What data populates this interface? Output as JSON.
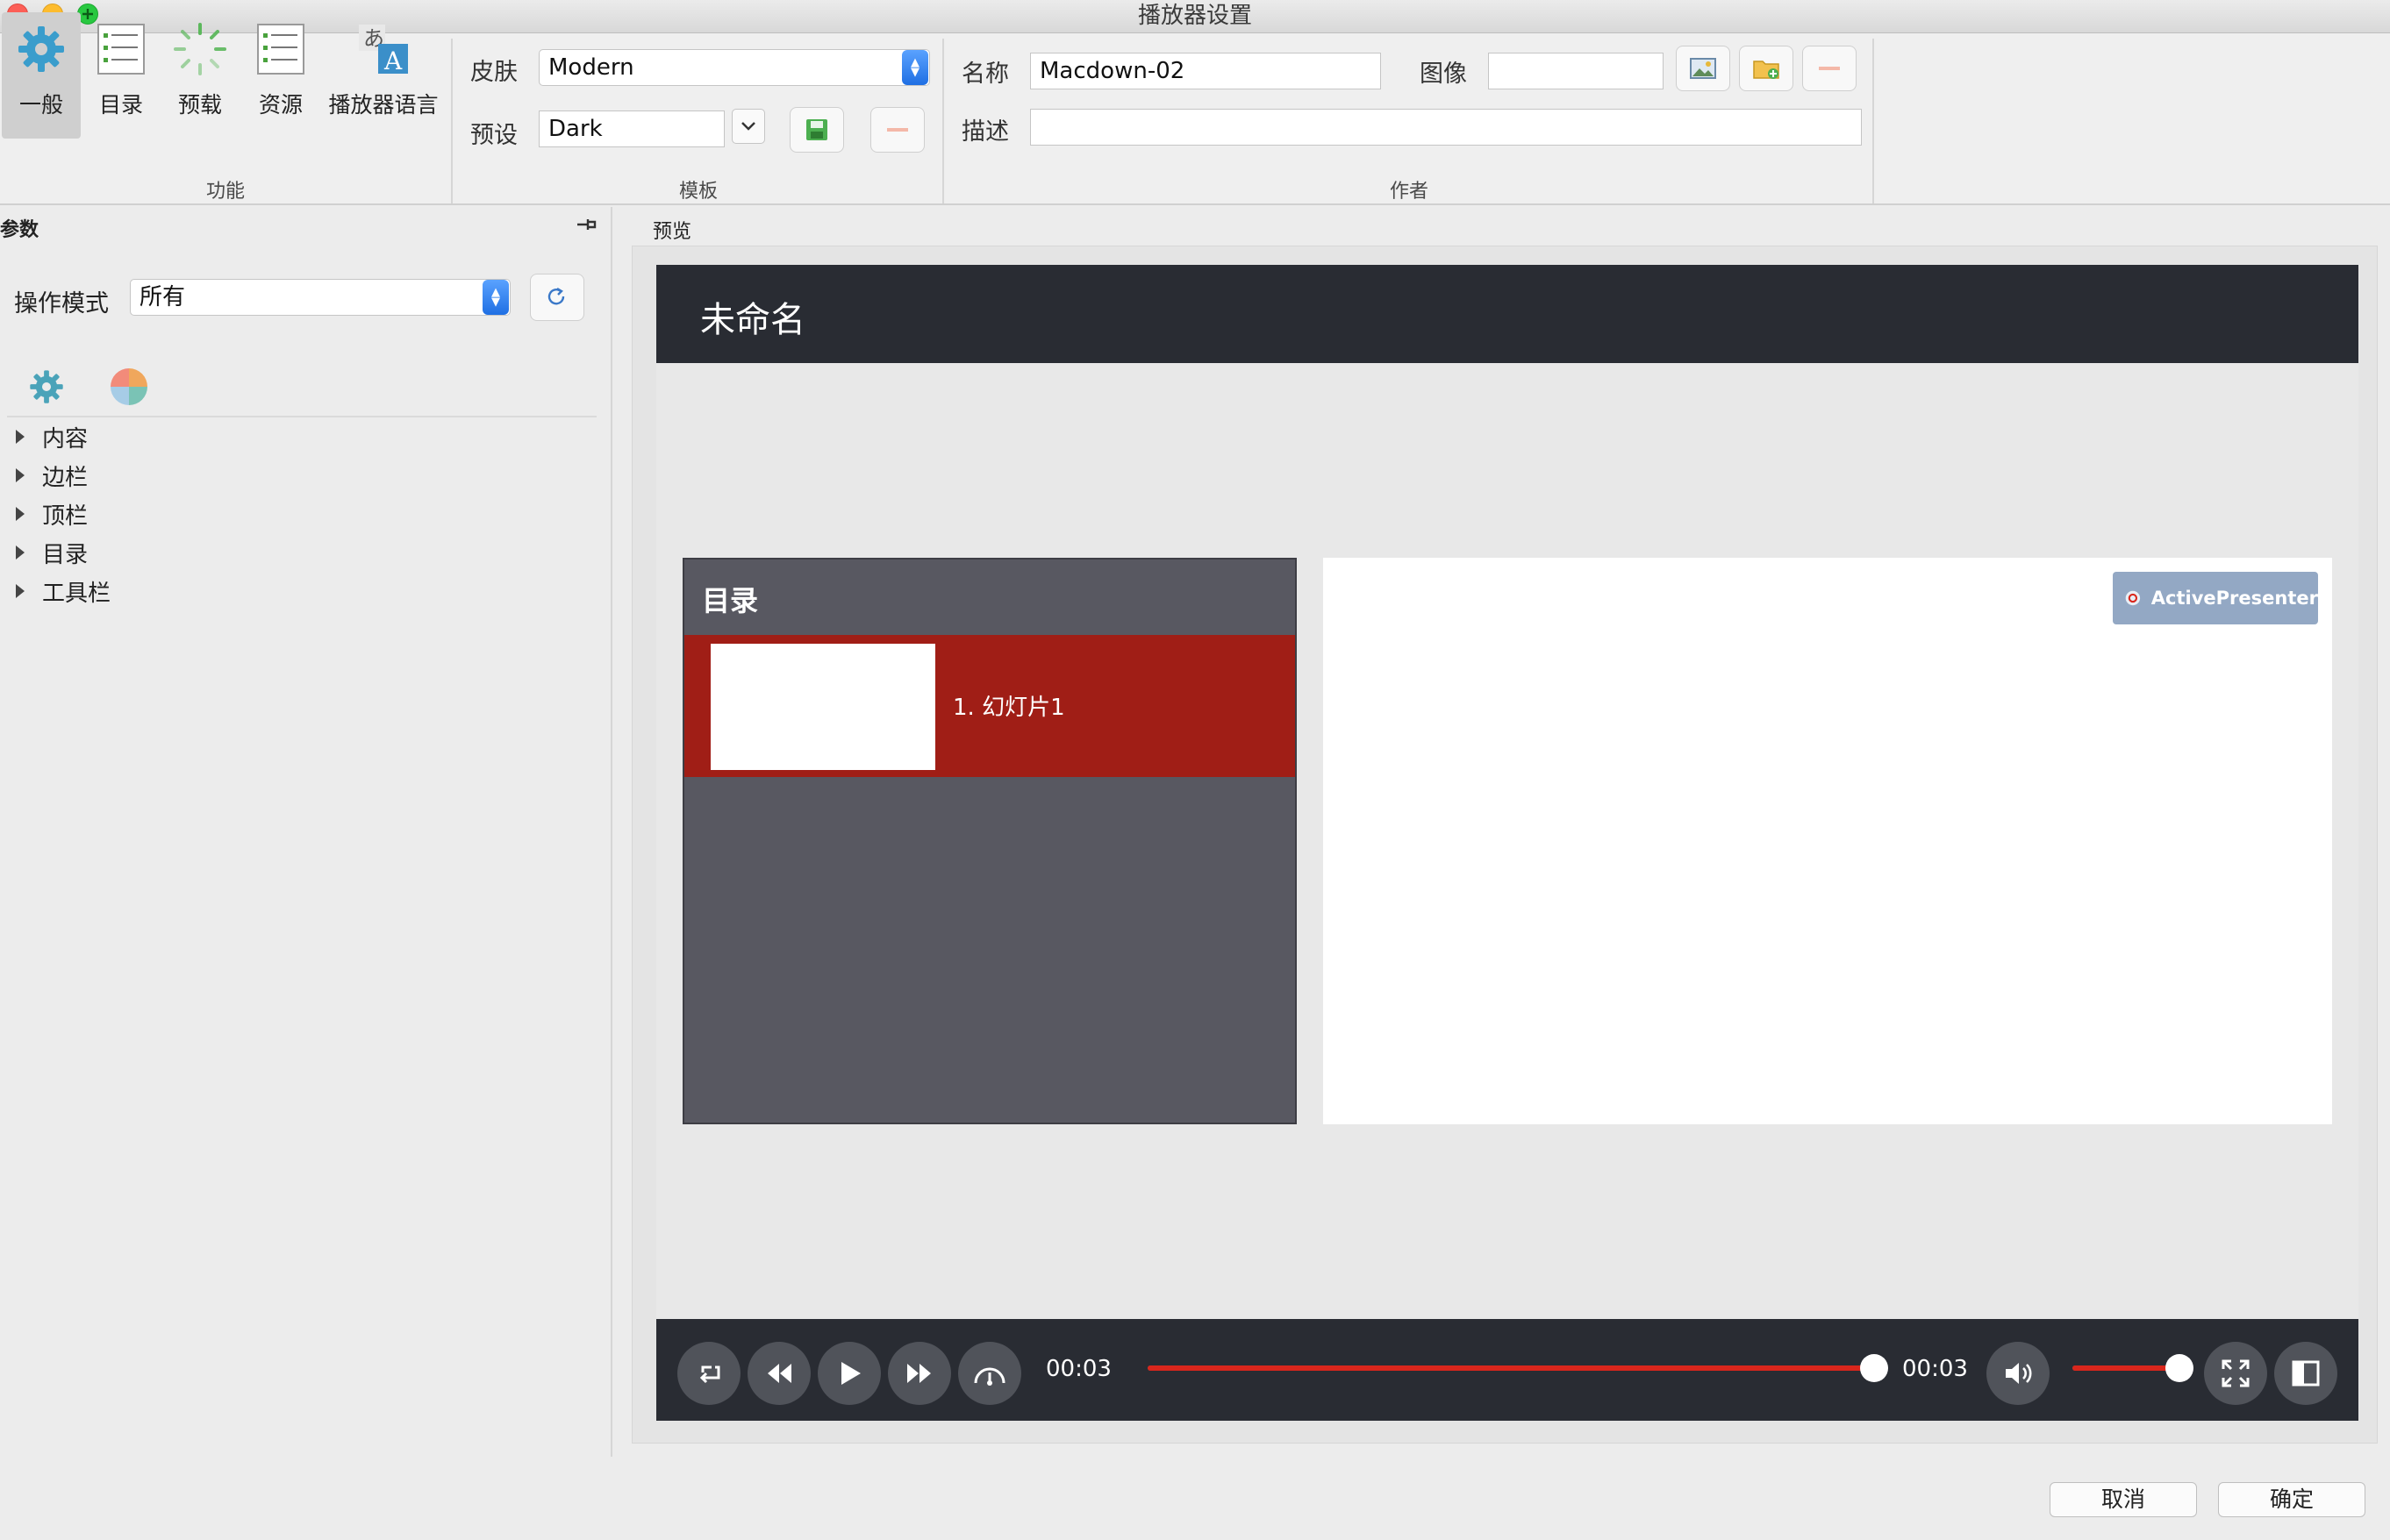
{
  "window": {
    "title": "播放器设置"
  },
  "ribbon": {
    "function_group": {
      "label": "功能",
      "buttons": [
        {
          "label": "一般",
          "icon": "gear-icon",
          "selected": true
        },
        {
          "label": "目录",
          "icon": "list-icon"
        },
        {
          "label": "预载",
          "icon": "loading-spinner-icon"
        },
        {
          "label": "资源",
          "icon": "resources-list-icon"
        },
        {
          "label": "播放器语言",
          "icon": "language-icon"
        }
      ]
    },
    "template_group": {
      "label": "模板",
      "skin_label": "皮肤",
      "skin_value": "Modern",
      "preset_label": "预设",
      "preset_value": "Dark"
    },
    "author_group": {
      "label": "作者",
      "name_label": "名称",
      "name_value": "Macdown-02",
      "image_label": "图像",
      "image_value": "",
      "description_label": "描述",
      "description_value": ""
    }
  },
  "params_panel": {
    "title": "参数",
    "mode_label": "操作模式",
    "mode_value": "所有",
    "tree": [
      "内容",
      "边栏",
      "顶栏",
      "目录",
      "工具栏"
    ]
  },
  "preview": {
    "label": "预览",
    "player_title": "未命名",
    "toc_title": "目录",
    "toc_items": [
      "1. 幻灯片1"
    ],
    "watermark": "ActivePresenter",
    "current_time": "00:03",
    "total_time": "00:03",
    "progress": 1.0,
    "volume": 1.0,
    "accent_color": "#d9261c",
    "toc_selected_color": "#a01e16"
  },
  "footer": {
    "cancel": "取消",
    "ok": "确定"
  }
}
